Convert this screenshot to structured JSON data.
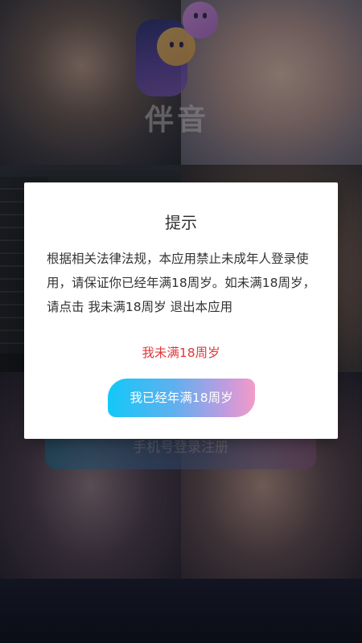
{
  "app": {
    "name": "伴音"
  },
  "background": {
    "register_button_label": "手机号登录注册"
  },
  "dialog": {
    "title": "提示",
    "body": "根据相关法律法规，本应用禁止未成年人登录使用，请保证你已经年满18周岁。如未满18周岁，请点击 我未满18周岁 退出本应用",
    "under18_label": "我未满18周岁",
    "adult_label": "我已经年满18周岁"
  },
  "colors": {
    "under18_text": "#e0383a",
    "adult_gradient_start": "#13c8f8",
    "adult_gradient_end": "#f39bc7"
  }
}
